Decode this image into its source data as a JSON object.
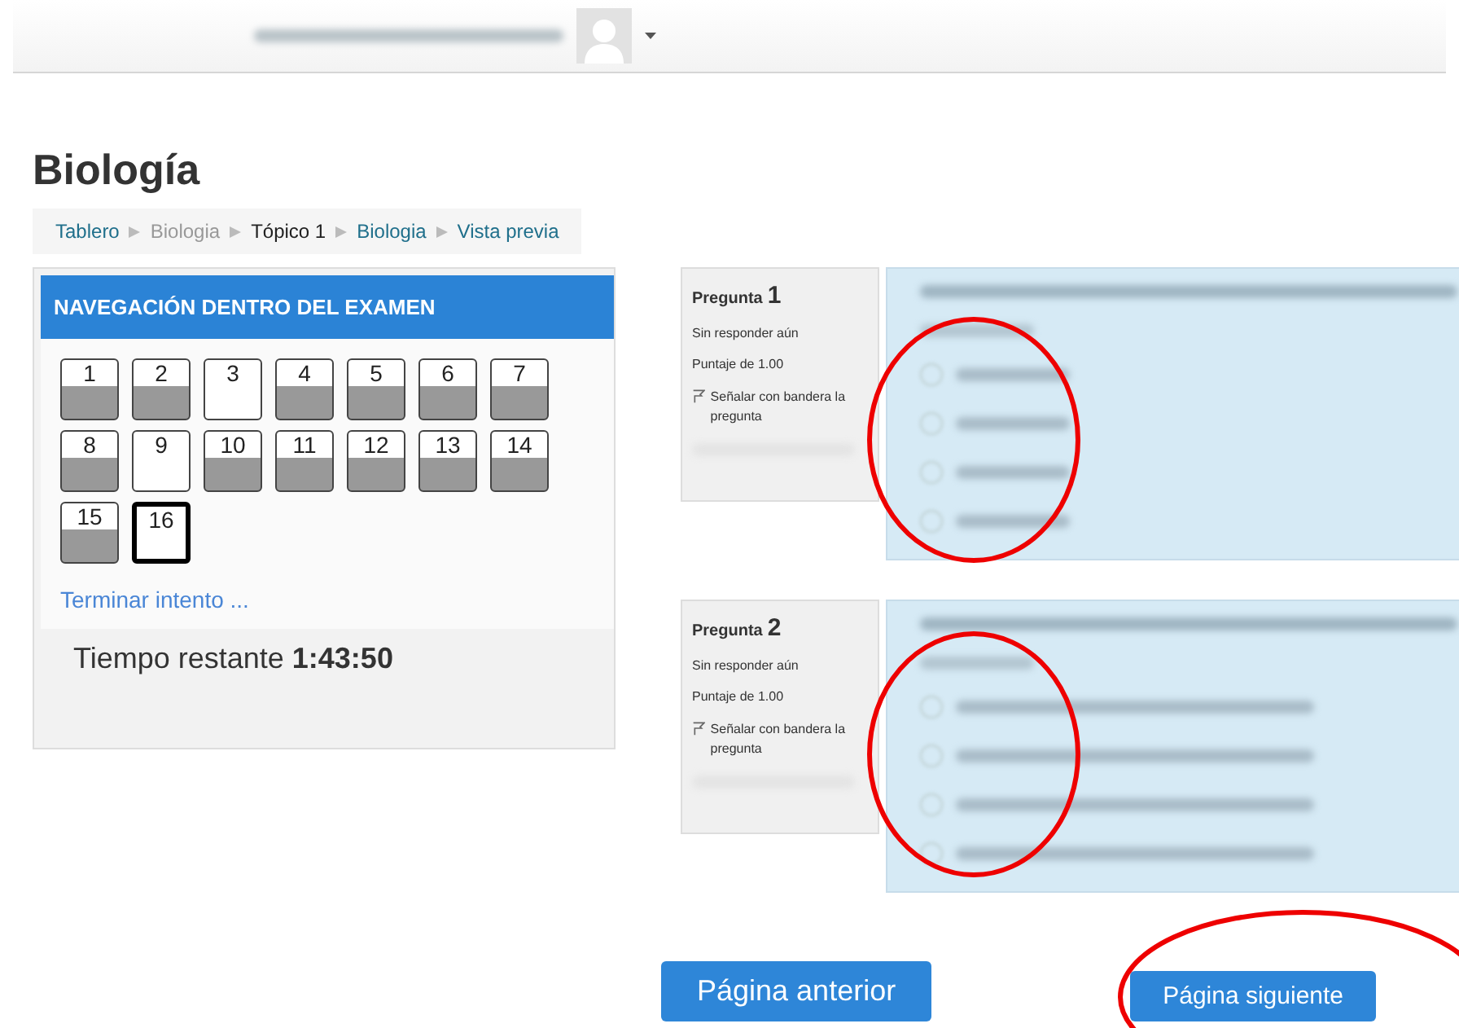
{
  "page_title": "Biología",
  "breadcrumb": [
    {
      "label": "Tablero",
      "kind": "link"
    },
    {
      "label": "Biologia",
      "kind": "muted"
    },
    {
      "label": "Tópico 1",
      "kind": "current"
    },
    {
      "label": "Biologia",
      "kind": "link"
    },
    {
      "label": "Vista previa",
      "kind": "link"
    }
  ],
  "quiz_navigation": {
    "title": "NAVEGACIÓN DENTRO DEL EXAMEN",
    "questions": [
      {
        "label": "1",
        "answered": true,
        "current": false
      },
      {
        "label": "2",
        "answered": true,
        "current": false
      },
      {
        "label": "3",
        "answered": false,
        "current": false
      },
      {
        "label": "4",
        "answered": true,
        "current": false
      },
      {
        "label": "5",
        "answered": true,
        "current": false
      },
      {
        "label": "6",
        "answered": true,
        "current": false
      },
      {
        "label": "7",
        "answered": true,
        "current": false
      },
      {
        "label": "8",
        "answered": true,
        "current": false
      },
      {
        "label": "9",
        "answered": false,
        "current": false
      },
      {
        "label": "10",
        "answered": true,
        "current": false
      },
      {
        "label": "11",
        "answered": true,
        "current": false
      },
      {
        "label": "12",
        "answered": true,
        "current": false
      },
      {
        "label": "13",
        "answered": true,
        "current": false
      },
      {
        "label": "14",
        "answered": true,
        "current": false
      },
      {
        "label": "15",
        "answered": true,
        "current": false
      },
      {
        "label": "16",
        "answered": false,
        "current": true
      }
    ],
    "finish_link": "Terminar intento ...",
    "timer": "Tiempo restante **1:43:50**"
  },
  "questions": [
    {
      "label": "Pregunta",
      "number": "1",
      "status": "Sin responder aún",
      "score": "Puntaje de 1.00",
      "flag": "Señalar con bandera la pregunta",
      "options": [
        {
          "selected": false
        },
        {
          "selected": false
        },
        {
          "selected": false
        },
        {
          "selected": false
        }
      ]
    },
    {
      "label": "Pregunta",
      "number": "2",
      "status": "Sin responder aún",
      "score": "Puntaje de 1.00",
      "flag": "Señalar con bandera la pregunta",
      "options": [
        {
          "selected": false
        },
        {
          "selected": false
        },
        {
          "selected": false
        },
        {
          "selected": false
        }
      ]
    }
  ],
  "buttons": [
    {
      "label": "Página anterior",
      "kind": "previous"
    },
    {
      "label": "Página siguiente",
      "kind": "next"
    }
  ]
}
